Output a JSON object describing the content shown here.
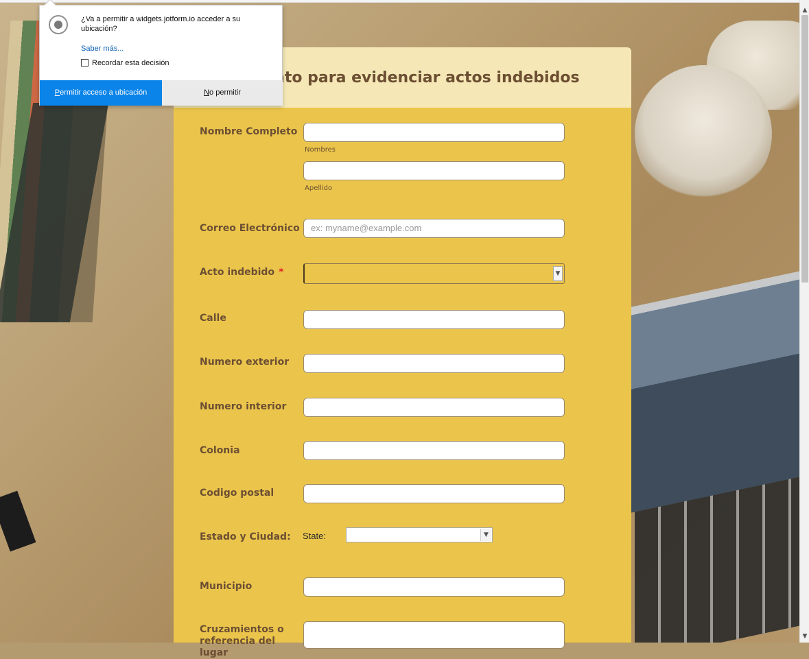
{
  "popup": {
    "question": "¿Va a permitir a widgets.jotform.io acceder a su ubicación?",
    "learn_more": "Saber más...",
    "remember_label": "Recordar esta decisión",
    "allow_key": "P",
    "allow_rest": "ermitir acceso a ubicación",
    "deny_key": "N",
    "deny_rest": "o permitir"
  },
  "form": {
    "title_visible": "ato para evidenciar actos indebidos",
    "fields": {
      "nombre_label": "Nombre Completo",
      "nombres_sublabel": "Nombres",
      "apellido_sublabel": "Apellido",
      "correo_label": "Correo Electrónico",
      "correo_placeholder": "ex: myname@example.com",
      "acto_label": "Acto indebido",
      "calle_label": "Calle",
      "num_ext_label": "Numero exterior",
      "num_int_label": "Numero interior",
      "colonia_label": "Colonia",
      "cp_label": "Codigo postal",
      "estado_label": "Estado y Ciudad:",
      "state_label": "State:",
      "municipio_label": "Municipio",
      "cruzamientos_label": "Cruzamientos o referencia del lugar"
    },
    "required_mark": "*"
  },
  "colors": {
    "form_body": "#ebc54b",
    "form_header": "#f6e8b6",
    "label_text": "#6c4f33",
    "required": "#e02525",
    "allow_button": "#0a84e8"
  }
}
